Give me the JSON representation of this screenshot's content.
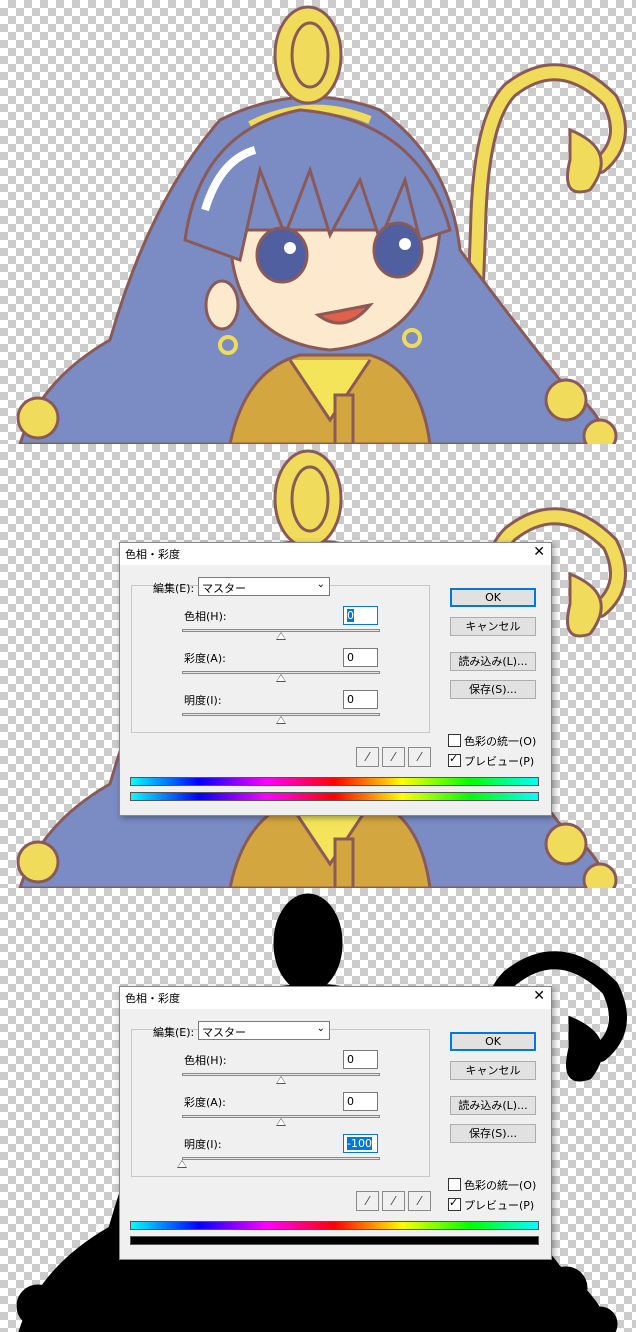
{
  "panels": [
    {
      "art_mode": "color",
      "show_dialog": false
    },
    {
      "art_mode": "color",
      "show_dialog": true,
      "dialog": {
        "title": "色相・彩度",
        "close_icon": "close-icon",
        "edit_label": "編集(E):",
        "edit_value": "マスター",
        "hue_label": "色相(H):",
        "hue_value": "0",
        "hue_level": 0,
        "saturation_label": "彩度(A):",
        "saturation_value": "0",
        "saturation_level": 0,
        "lightness_label": "明度(I):",
        "lightness_value": "0",
        "lightness_level": 0,
        "focused_field": "hue",
        "ok_label": "OK",
        "cancel_label": "キャンセル",
        "load_label": "読み込み(L)...",
        "save_label": "保存(S)...",
        "colorize_label": "色彩の統一(O)",
        "colorize_checked": false,
        "preview_label": "プレビュー(P)",
        "preview_checked": true,
        "eyedroppers": [
          "eyedropper-icon",
          "eyedropper-plus-icon",
          "eyedropper-minus-icon"
        ],
        "result_bar": "hue"
      }
    },
    {
      "art_mode": "black",
      "show_dialog": true,
      "dialog": {
        "title": "色相・彩度",
        "close_icon": "close-icon",
        "edit_label": "編集(E):",
        "edit_value": "マスター",
        "hue_label": "色相(H):",
        "hue_value": "0",
        "hue_level": 0,
        "saturation_label": "彩度(A):",
        "saturation_value": "0",
        "saturation_level": 0,
        "lightness_label": "明度(I):",
        "lightness_value": "-100",
        "lightness_level": -100,
        "focused_field": "lightness",
        "ok_label": "OK",
        "cancel_label": "キャンセル",
        "load_label": "読み込み(L)...",
        "save_label": "保存(S)...",
        "colorize_label": "色彩の統一(O)",
        "colorize_checked": false,
        "preview_label": "プレビュー(P)",
        "preview_checked": true,
        "eyedroppers": [
          "eyedropper-icon",
          "eyedropper-plus-icon",
          "eyedropper-minus-icon"
        ],
        "result_bar": "black"
      }
    }
  ],
  "colors": {
    "hair": "#7b8cc4",
    "skin": "#fde9cd",
    "gold": "#f0dc5a",
    "outline": "#8a5a58",
    "coat": "#d3a640",
    "accent": "#0078d7"
  }
}
